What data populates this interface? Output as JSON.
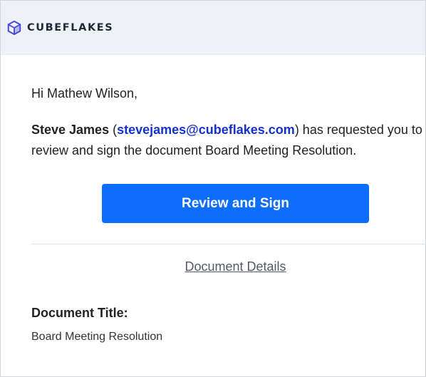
{
  "brand": {
    "name": "CUBEFLAKES",
    "logo_icon": "cube-logo-icon",
    "accent_color": "#4a4ae0"
  },
  "email": {
    "greeting": "Hi Mathew Wilson,",
    "sender_name": "Steve James",
    "open_paren": "(",
    "sender_email": "stevejames@cubeflakes.com",
    "message_rest": ") has requested you to review and sign the document Board Meeting Resolution.",
    "cta_label": "Review and Sign",
    "cta_color": "#0d6efd",
    "details_link": "Document Details",
    "doc_title_label": "Document Title:",
    "doc_title_value": "Board Meeting Resolution"
  }
}
